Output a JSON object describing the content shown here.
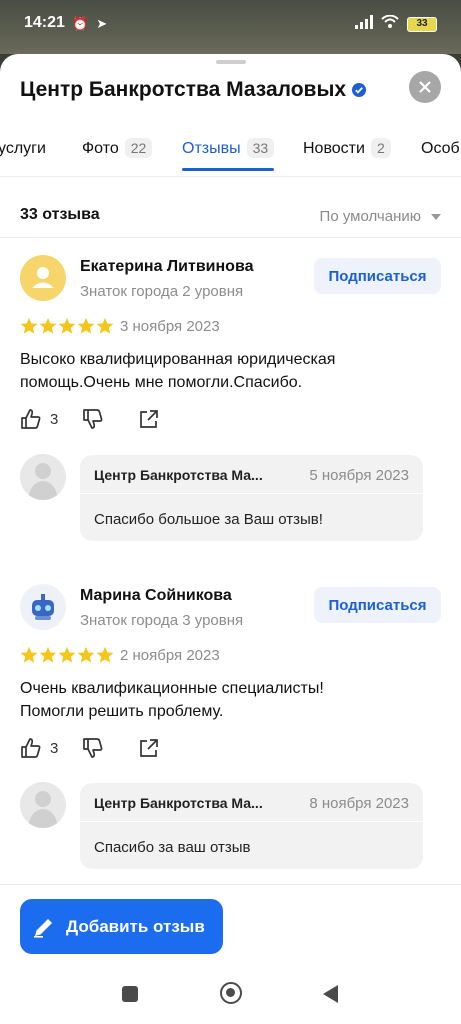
{
  "status_bar": {
    "time": "14:21",
    "battery": "33"
  },
  "header": {
    "title": "Центр Банкротства Мазаловых"
  },
  "tabs": [
    {
      "label": "услуги",
      "count": ""
    },
    {
      "label": "Фото",
      "count": "22"
    },
    {
      "label": "Отзывы",
      "count": "33",
      "active": true
    },
    {
      "label": "Новости",
      "count": "2"
    },
    {
      "label": "Особ",
      "count": ""
    }
  ],
  "reviews_header": {
    "count_label": "33 отзыва",
    "sort_label": "По умолчанию"
  },
  "reviews": [
    {
      "author": "Екатерина Литвинова",
      "level": "Знаток города 2 уровня",
      "subscribe_label": "Подписаться",
      "stars": 5,
      "date": "3 ноября 2023",
      "text_line1": "Высоко квалифицированная юридическая",
      "text_line2": "помощь.Очень мне помогли.Спасибо.",
      "likes": "3",
      "reply": {
        "org": "Центр Банкротства Ма...",
        "date": "5 ноября 2023",
        "text": "Спасибо большое за Ваш отзыв!"
      }
    },
    {
      "author": "Марина Сойникова",
      "level": "Знаток города 3 уровня",
      "subscribe_label": "Подписаться",
      "stars": 5,
      "date": "2 ноября 2023",
      "text_line1": "Очень квалификационные специалисты!",
      "text_line2": "Помогли решить проблему.",
      "likes": "3",
      "reply": {
        "org": "Центр Банкротства Ма...",
        "date": "8 ноября 2023",
        "text": "Спасибо за ваш отзыв"
      }
    }
  ],
  "add_review_label": "Добавить отзыв",
  "colors": {
    "accent": "#1c6cf0",
    "tab_active": "#1a5fd8",
    "star": "#f5c518"
  }
}
